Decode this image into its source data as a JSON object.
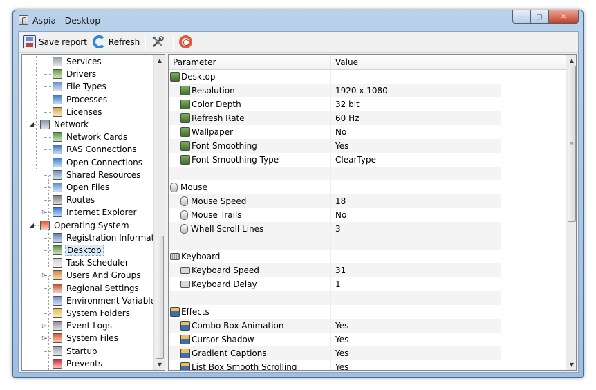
{
  "window": {
    "title": "Aspia - Desktop",
    "controls": [
      "—",
      "□",
      "✕"
    ]
  },
  "toolbar": {
    "save_label": "Save report",
    "refresh_label": "Refresh"
  },
  "tree": [
    {
      "label": "Services",
      "icon": "services-icon",
      "color": "#9aa0a8",
      "depth": 2
    },
    {
      "label": "Drivers",
      "icon": "drivers-icon",
      "color": "#6aa040",
      "depth": 2
    },
    {
      "label": "File Types",
      "icon": "file-types-icon",
      "color": "#6f8fc9",
      "depth": 2
    },
    {
      "label": "Processes",
      "icon": "processes-icon",
      "color": "#3a78c0",
      "depth": 2
    },
    {
      "label": "Licenses",
      "icon": "licenses-icon",
      "color": "#e0a640",
      "depth": 2
    },
    {
      "label": "Network",
      "icon": "network-icon",
      "color": "#8a95a5",
      "depth": 1,
      "expanded": true
    },
    {
      "label": "Network Cards",
      "icon": "network-card-icon",
      "color": "#4f9a3a",
      "depth": 2
    },
    {
      "label": "RAS Connections",
      "icon": "ras-icon",
      "color": "#3b72c4",
      "depth": 2
    },
    {
      "label": "Open Connections",
      "icon": "connections-icon",
      "color": "#3d7fd0",
      "depth": 2
    },
    {
      "label": "Shared Resources",
      "icon": "shared-icon",
      "color": "#6f90b8",
      "depth": 2
    },
    {
      "label": "Open Files",
      "icon": "open-files-icon",
      "color": "#5d8ed0",
      "depth": 2
    },
    {
      "label": "Routes",
      "icon": "routes-icon",
      "color": "#7a7a7a",
      "depth": 2
    },
    {
      "label": "Internet Explorer",
      "icon": "ie-icon",
      "color": "#3b86d6",
      "depth": 2,
      "collapsed": true
    },
    {
      "label": "Operating System",
      "icon": "windows-icon",
      "color": "#e05a2a",
      "depth": 1,
      "expanded": true
    },
    {
      "label": "Registration Information",
      "icon": "registration-icon",
      "color": "#5a7fb0",
      "depth": 2
    },
    {
      "label": "Desktop",
      "icon": "desktop-icon",
      "color": "#5f9a3f",
      "depth": 2,
      "selected": true
    },
    {
      "label": "Task Scheduler",
      "icon": "clock-icon",
      "color": "#cfcfcf",
      "depth": 2
    },
    {
      "label": "Users And Groups",
      "icon": "users-icon",
      "color": "#d9863a",
      "depth": 2,
      "collapsed": true
    },
    {
      "label": "Regional Settings",
      "icon": "regional-icon",
      "color": "#c05030",
      "depth": 2
    },
    {
      "label": "Environment Variables",
      "icon": "environment-icon",
      "color": "#6f8fc9",
      "depth": 2
    },
    {
      "label": "System Folders",
      "icon": "folders-icon",
      "color": "#e8c04a",
      "depth": 2
    },
    {
      "label": "Event Logs",
      "icon": "event-logs-icon",
      "color": "#8a8f99",
      "depth": 2,
      "collapsed": true
    },
    {
      "label": "System Files",
      "icon": "system-files-icon",
      "color": "#e05a2a",
      "depth": 2,
      "collapsed": true
    },
    {
      "label": "Startup",
      "icon": "startup-icon",
      "color": "#a0a8b4",
      "depth": 2
    },
    {
      "label": "Prevents",
      "icon": "prevents-icon",
      "color": "#d8232a",
      "depth": 2
    }
  ],
  "list": {
    "columns": [
      "Parameter",
      "Value"
    ],
    "rows": [
      {
        "kind": "group",
        "icon": "desktop",
        "param": "Desktop",
        "value": ""
      },
      {
        "kind": "item",
        "icon": "desktop",
        "param": "Resolution",
        "value": "1920 x 1080"
      },
      {
        "kind": "item",
        "icon": "desktop",
        "param": "Color Depth",
        "value": "32 bit"
      },
      {
        "kind": "item",
        "icon": "desktop",
        "param": "Refresh Rate",
        "value": "60 Hz"
      },
      {
        "kind": "item",
        "icon": "desktop",
        "param": "Wallpaper",
        "value": "No"
      },
      {
        "kind": "item",
        "icon": "desktop",
        "param": "Font Smoothing",
        "value": "Yes"
      },
      {
        "kind": "item",
        "icon": "desktop",
        "param": "Font Smoothing Type",
        "value": "ClearType"
      },
      {
        "kind": "blank",
        "param": "",
        "value": ""
      },
      {
        "kind": "group",
        "icon": "mouse",
        "param": "Mouse",
        "value": ""
      },
      {
        "kind": "item",
        "icon": "mouse",
        "param": "Mouse Speed",
        "value": "18"
      },
      {
        "kind": "item",
        "icon": "mouse",
        "param": "Mouse Trails",
        "value": "No"
      },
      {
        "kind": "item",
        "icon": "mouse",
        "param": "Whell Scroll Lines",
        "value": "3"
      },
      {
        "kind": "blank",
        "param": "",
        "value": ""
      },
      {
        "kind": "group",
        "icon": "keyboard",
        "param": "Keyboard",
        "value": ""
      },
      {
        "kind": "item",
        "icon": "keyboard",
        "param": "Keyboard Speed",
        "value": "31"
      },
      {
        "kind": "item",
        "icon": "keyboard",
        "param": "Keyboard Delay",
        "value": "1"
      },
      {
        "kind": "blank",
        "param": "",
        "value": ""
      },
      {
        "kind": "group",
        "icon": "effects",
        "param": "Effects",
        "value": ""
      },
      {
        "kind": "item",
        "icon": "effects",
        "param": "Combo Box Animation",
        "value": "Yes"
      },
      {
        "kind": "item",
        "icon": "effects",
        "param": "Cursor Shadow",
        "value": "Yes"
      },
      {
        "kind": "item",
        "icon": "effects",
        "param": "Gradient Captions",
        "value": "Yes"
      },
      {
        "kind": "item",
        "icon": "effects",
        "param": "List Box Smooth Scrolling",
        "value": "Yes"
      }
    ]
  }
}
